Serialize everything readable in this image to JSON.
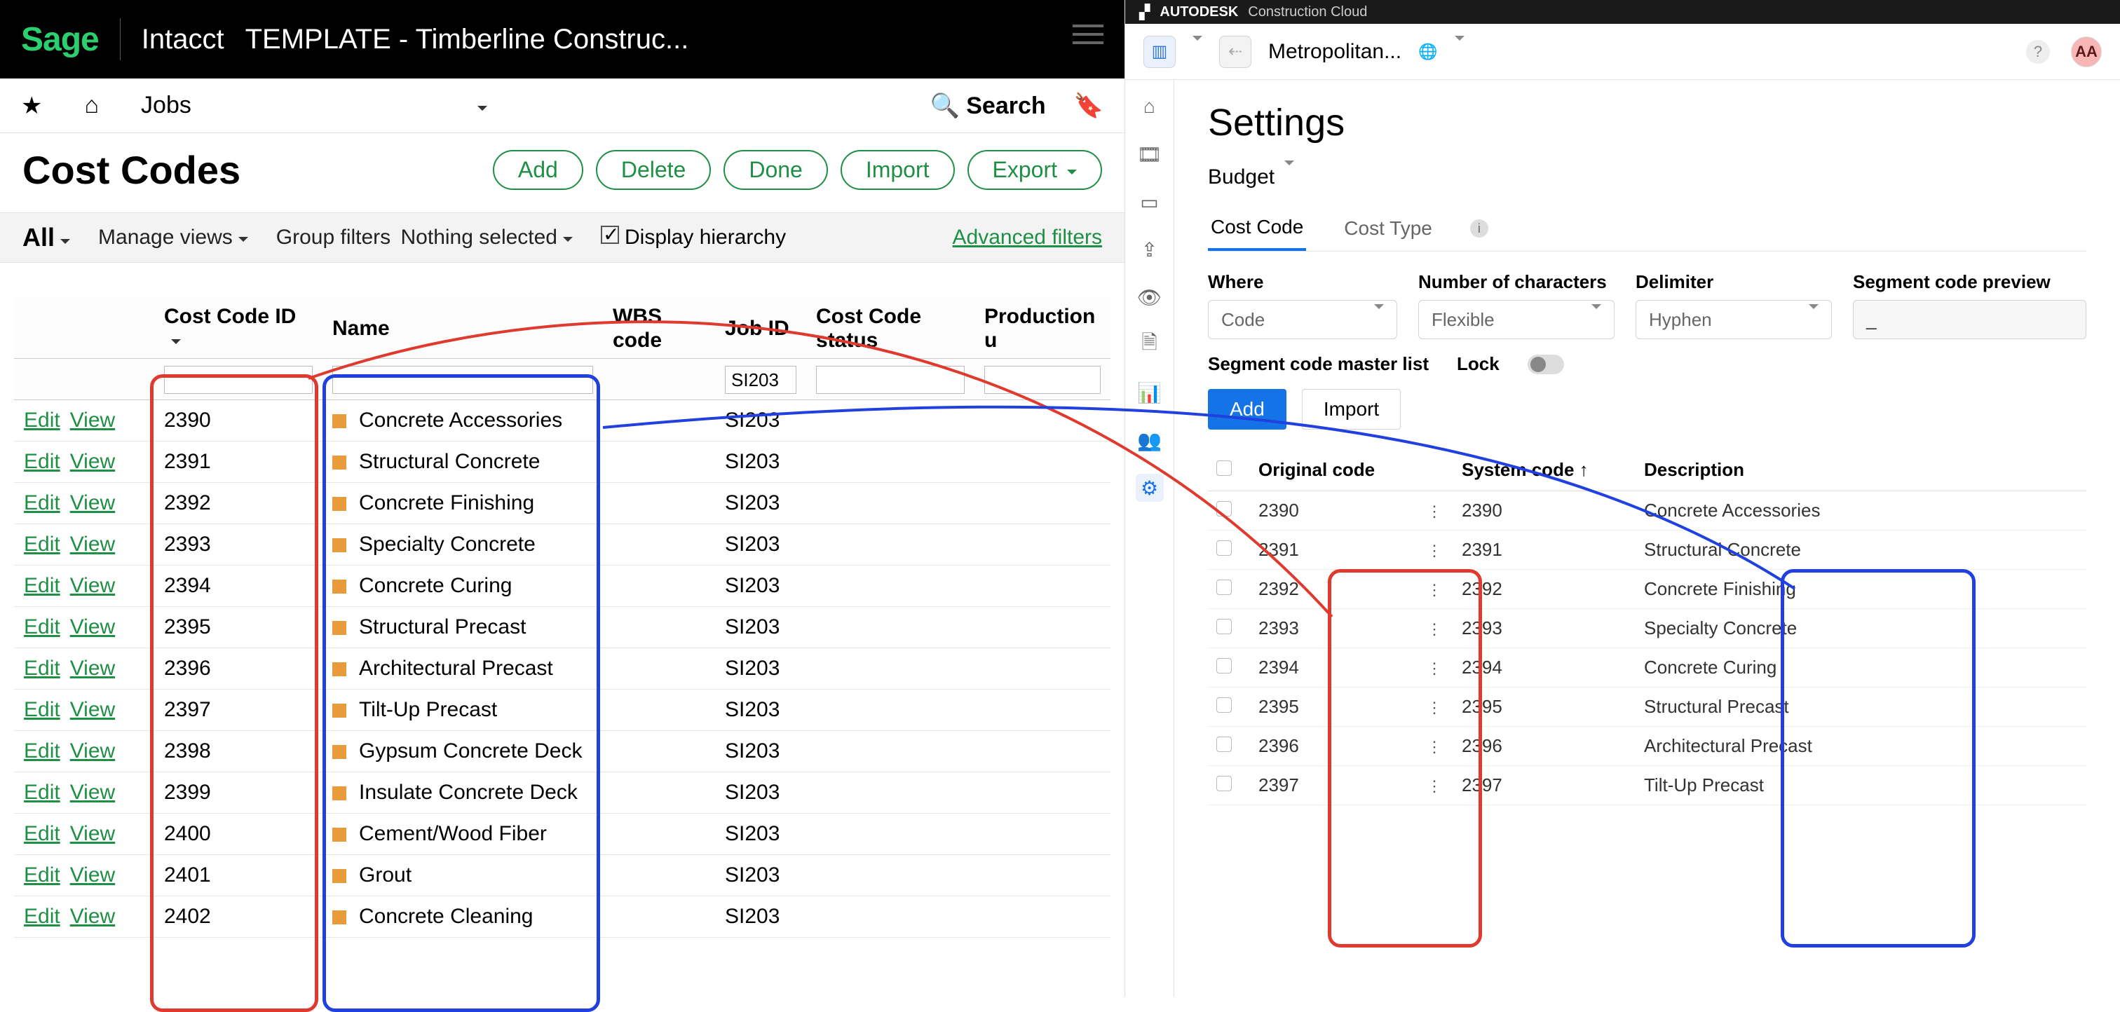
{
  "sage": {
    "logo": "Sage",
    "product": "Intacct",
    "template": "TEMPLATE - Timberline Construc...",
    "nav": {
      "jobs": "Jobs",
      "search": "Search"
    },
    "page_title": "Cost Codes",
    "buttons": {
      "add": "Add",
      "delete": "Delete",
      "done": "Done",
      "import": "Import",
      "export": "Export"
    },
    "filter": {
      "all": "All",
      "manage": "Manage views",
      "group": "Group filters",
      "group_val": "Nothing selected",
      "display": "Display hierarchy",
      "advanced": "Advanced filters"
    },
    "columns": {
      "actions": "",
      "ccid": "Cost Code ID",
      "name": "Name",
      "wbs": "WBS code",
      "job": "Job ID",
      "status": "Cost Code status",
      "prod": "Production u"
    },
    "job_filter": "SI203",
    "rows": [
      {
        "id": "2390",
        "name": "Concrete Accessories",
        "job": "SI203"
      },
      {
        "id": "2391",
        "name": "Structural Concrete",
        "job": "SI203"
      },
      {
        "id": "2392",
        "name": "Concrete Finishing",
        "job": "SI203"
      },
      {
        "id": "2393",
        "name": "Specialty Concrete",
        "job": "SI203"
      },
      {
        "id": "2394",
        "name": "Concrete Curing",
        "job": "SI203"
      },
      {
        "id": "2395",
        "name": "Structural Precast",
        "job": "SI203"
      },
      {
        "id": "2396",
        "name": "Architectural Precast",
        "job": "SI203"
      },
      {
        "id": "2397",
        "name": "Tilt-Up Precast",
        "job": "SI203"
      },
      {
        "id": "2398",
        "name": "Gypsum Concrete Deck",
        "job": "SI203"
      },
      {
        "id": "2399",
        "name": "Insulate Concrete Deck",
        "job": "SI203"
      },
      {
        "id": "2400",
        "name": "Cement/Wood Fiber",
        "job": "SI203"
      },
      {
        "id": "2401",
        "name": "Grout",
        "job": "SI203"
      },
      {
        "id": "2402",
        "name": "Concrete Cleaning",
        "job": "SI203"
      }
    ],
    "action": {
      "edit": "Edit",
      "view": "View"
    }
  },
  "adsk": {
    "brand1": "AUTODESK",
    "brand2": "Construction Cloud",
    "project": "Metropolitan...",
    "avatar": "AA",
    "title": "Settings",
    "budget": "Budget",
    "tabs": {
      "cc": "Cost Code",
      "ct": "Cost Type"
    },
    "fields": {
      "where_l": "Where",
      "where_v": "Code",
      "num_l": "Number of characters",
      "num_v": "Flexible",
      "delim_l": "Delimiter",
      "delim_v": "Hyphen",
      "prev_l": "Segment code preview",
      "prev_v": "_"
    },
    "master": "Segment code master list",
    "lock": "Lock",
    "btn": {
      "add": "Add",
      "import": "Import"
    },
    "cols": {
      "orig": "Original code",
      "sys": "System code",
      "desc": "Description"
    },
    "rows": [
      {
        "o": "2390",
        "s": "2390",
        "d": "Concrete Accessories"
      },
      {
        "o": "2391",
        "s": "2391",
        "d": "Structural Concrete"
      },
      {
        "o": "2392",
        "s": "2392",
        "d": "Concrete Finishing"
      },
      {
        "o": "2393",
        "s": "2393",
        "d": "Specialty Concrete"
      },
      {
        "o": "2394",
        "s": "2394",
        "d": "Concrete Curing"
      },
      {
        "o": "2395",
        "s": "2395",
        "d": "Structural Precast"
      },
      {
        "o": "2396",
        "s": "2396",
        "d": "Architectural Precast"
      },
      {
        "o": "2397",
        "s": "2397",
        "d": "Tilt-Up Precast"
      }
    ]
  }
}
